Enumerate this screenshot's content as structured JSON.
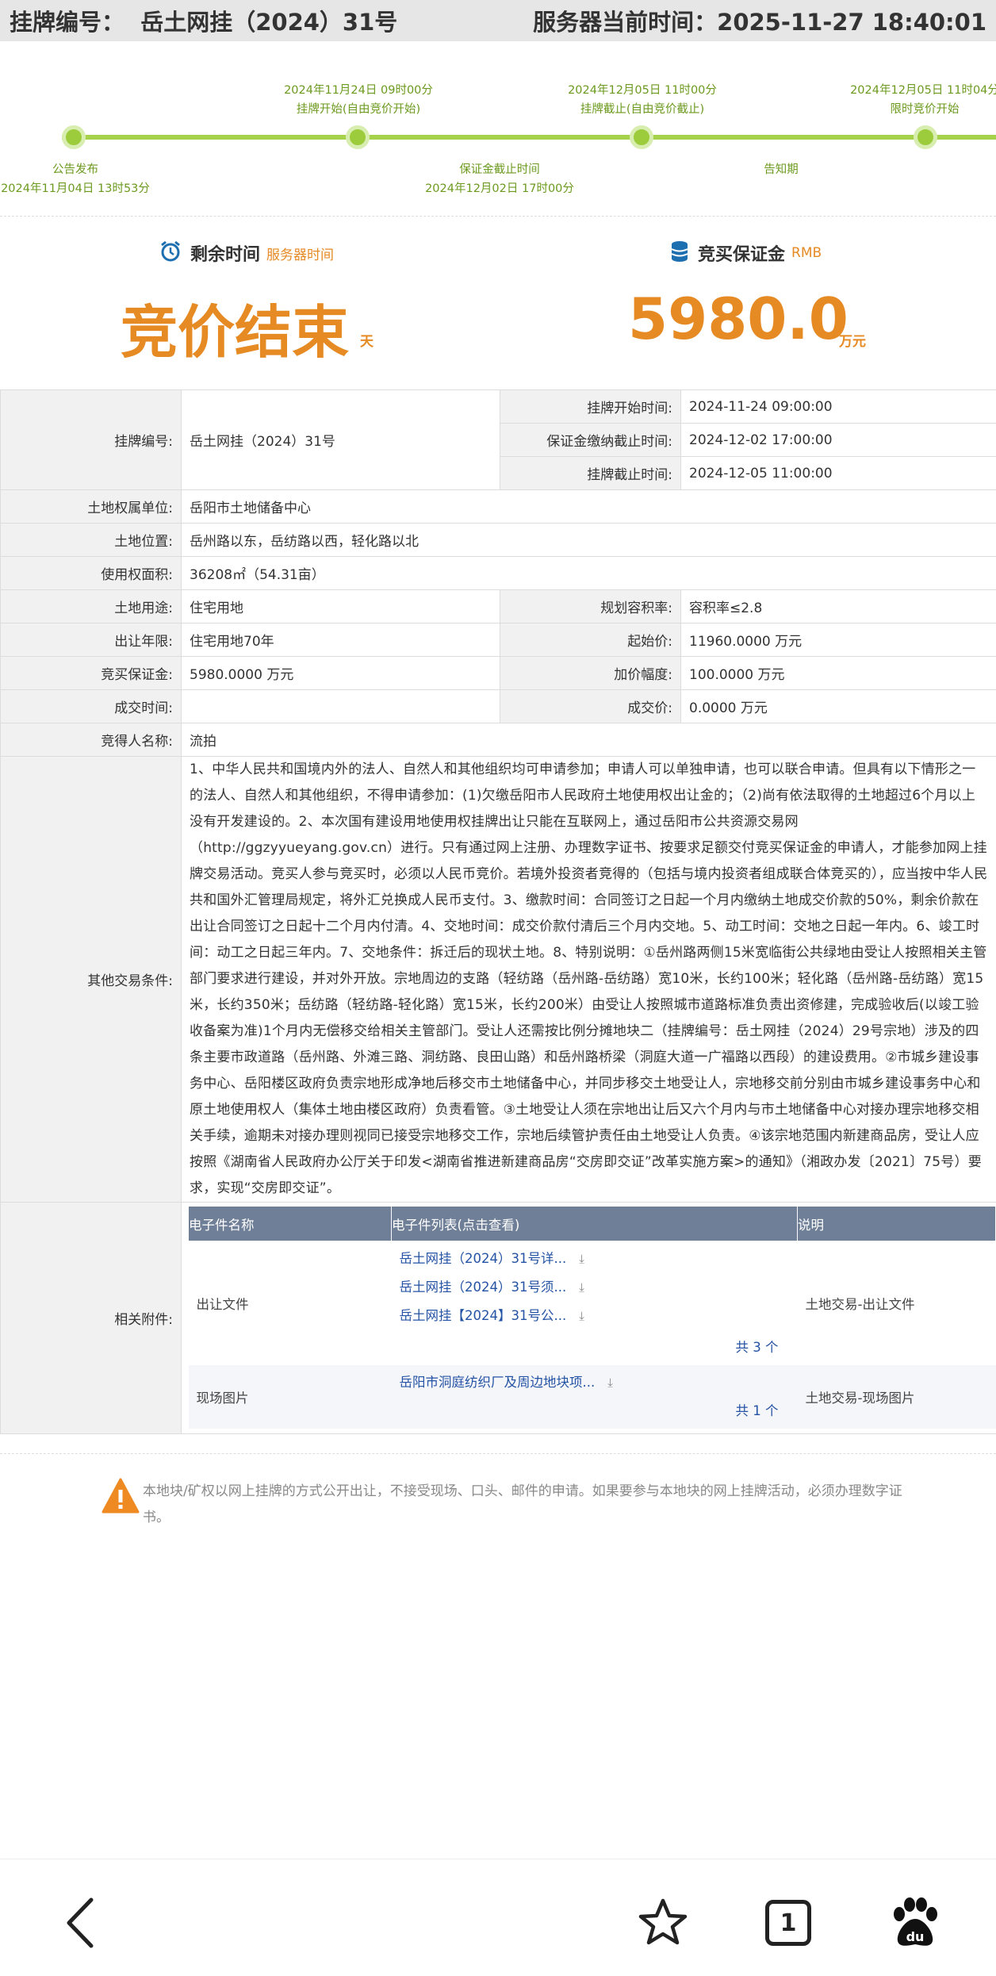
{
  "header": {
    "listing_label": "挂牌编号：",
    "listing_value": "岳土网挂（2024）31号",
    "server_time_label": "服务器当前时间：",
    "server_time_value": "2025-11-27 18:40:01"
  },
  "timeline": {
    "top": [
      {
        "date": "2024年11月24日 09时00分",
        "label": "挂牌开始(自由竞价开始)"
      },
      {
        "date": "2024年12月05日 11时00分",
        "label": "挂牌截止(自由竞价截止)"
      },
      {
        "date": "2024年12月05日 11时04分",
        "label": "限时竞价开始"
      }
    ],
    "bottom": [
      {
        "label": "公告发布",
        "date": "2024年11月04日 13时53分"
      },
      {
        "label": "保证金截止时间",
        "date": "2024年12月02日 17时00分"
      },
      {
        "label": "告知期",
        "date": ""
      }
    ]
  },
  "summary": {
    "remaining_title": "剩余时间",
    "remaining_sub": "服务器时间",
    "remaining_value": "竞价结束",
    "remaining_unit": "天",
    "deposit_title": "竞买保证金",
    "deposit_sub": "RMB",
    "deposit_value": "5980.0",
    "deposit_unit": "万元"
  },
  "info": {
    "listing_no_label": "挂牌编号:",
    "listing_no": "岳土网挂（2024）31号",
    "start_label": "挂牌开始时间:",
    "start_value": "2024-11-24 09:00:00",
    "deposit_deadline_label": "保证金缴纳截止时间:",
    "deposit_deadline_value": "2024-12-02 17:00:00",
    "end_label": "挂牌截止时间:",
    "end_value": "2024-12-05 11:00:00",
    "owner_label": "土地权属单位:",
    "owner_value": "岳阳市土地储备中心",
    "location_label": "土地位置:",
    "location_value": "岳州路以东，岳纺路以西，轻化路以北",
    "area_label": "使用权面积:",
    "area_value": "36208㎡（54.31亩）",
    "use_label": "土地用途:",
    "use_value": "住宅用地",
    "far_label": "规划容积率:",
    "far_value": "容积率≤2.8",
    "term_label": "出让年限:",
    "term_value": "住宅用地70年",
    "start_price_label": "起始价:",
    "start_price_value": "11960.0000",
    "start_price_unit": "万元",
    "deposit_label": "竞买保证金:",
    "deposit_value": "5980.0000",
    "deposit_unit": "万元",
    "increment_label": "加价幅度:",
    "increment_value": "100.0000",
    "increment_unit": "万元",
    "deal_time_label": "成交时间:",
    "deal_time_value": "",
    "deal_price_label": "成交价:",
    "deal_price_value": "0.0000",
    "deal_price_unit": "万元",
    "winner_label": "竞得人名称:",
    "winner_value": "流拍",
    "other_label": "其他交易条件:",
    "other_value": "1、中华人民共和国境内外的法人、自然人和其他组织均可申请参加；申请人可以单独申请，也可以联合申请。但具有以下情形之一的法人、自然人和其他组织，不得申请参加：(1)欠缴岳阳市人民政府土地使用权出让金的；（2)尚有依法取得的土地超过6个月以上没有开发建设的。2、本次国有建设用地使用权挂牌出让只能在互联网上，通过岳阳市公共资源交易网（http://ggzyyueyang.gov.cn）进行。只有通过网上注册、办理数字证书、按要求足额交付竞买保证金的申请人，才能参加网上挂牌交易活动。竞买人参与竞买时，必须以人民币竞价。若境外投资者竞得的（包括与境内投资者组成联合体竞买的），应当按中华人民共和国外汇管理局规定，将外汇兑换成人民币支付。3、缴款时间：合同签订之日起一个月内缴纳土地成交价款的50%，剩余价款在出让合同签订之日起十二个月内付清。4、交地时间：成交价款付清后三个月内交地。5、动工时间：交地之日起一年内。6、竣工时间：动工之日起三年内。7、交地条件：拆迁后的现状土地。8、特别说明：①岳州路两侧15米宽临街公共绿地由受让人按照相关主管部门要求进行建设，并对外开放。宗地周边的支路（轻纺路（岳州路-岳纺路）宽10米，长约100米；轻化路（岳州路-岳纺路）宽15米，长约350米；岳纺路（轻纺路-轻化路）宽15米，长约200米）由受让人按照城市道路标准负责出资修建，完成验收后(以竣工验收备案为准)1个月内无偿移交给相关主管部门。受让人还需按比例分摊地块二（挂牌编号：岳土网挂（2024）29号宗地）涉及的四条主要市政道路（岳州路、外滩三路、洞纺路、良田山路）和岳州路桥梁（洞庭大道一广福路以西段）的建设费用。②市城乡建设事务中心、岳阳楼区政府负责宗地形成净地后移交市土地储备中心，并同步移交土地受让人，宗地移交前分别由市城乡建设事务中心和原土地使用权人（集体土地由楼区政府）负责看管。③土地受让人须在宗地出让后又六个月内与市土地储备中心对接办理宗地移交相关手续，逾期未对接办理则视同已接受宗地移交工作，宗地后续管护责任由土地受让人负责。④该宗地范围内新建商品房，受让人应按照《湖南省人民政府办公厅关于印发<湖南省推进新建商品房“交房即交证”改革实施方案>的通知》（湘政办发〔2021〕75号）要求，实现“交房即交证”。",
    "attach_label": "相关附件:"
  },
  "attachments": {
    "headers": [
      "电子件名称",
      "电子件列表(点击查看)",
      "说明"
    ],
    "groups": [
      {
        "name": "出让文件",
        "files": [
          "岳土网挂（2024）31号详...",
          "岳土网挂（2024）31号须...",
          "岳土网挂【2024】31号公..."
        ],
        "count": "共 3 个",
        "desc": "土地交易-出让文件"
      },
      {
        "name": "现场图片",
        "files": [
          "岳阳市洞庭纺织厂及周边地块项..."
        ],
        "count": "共 1 个",
        "desc": "土地交易-现场图片"
      }
    ]
  },
  "notice": "本地块/矿权以网上挂牌的方式公开出让，不接受现场、口头、邮件的申请。如果要参与本地块的网上挂牌活动，必须办理数字证书。",
  "bottom_nav": {
    "tab_count": "1"
  },
  "colors": {
    "accent_orange": "#e68a24",
    "timeline_green": "#9ccc3c",
    "table_header": "#6f7f97",
    "link_blue": "#2553a4"
  }
}
